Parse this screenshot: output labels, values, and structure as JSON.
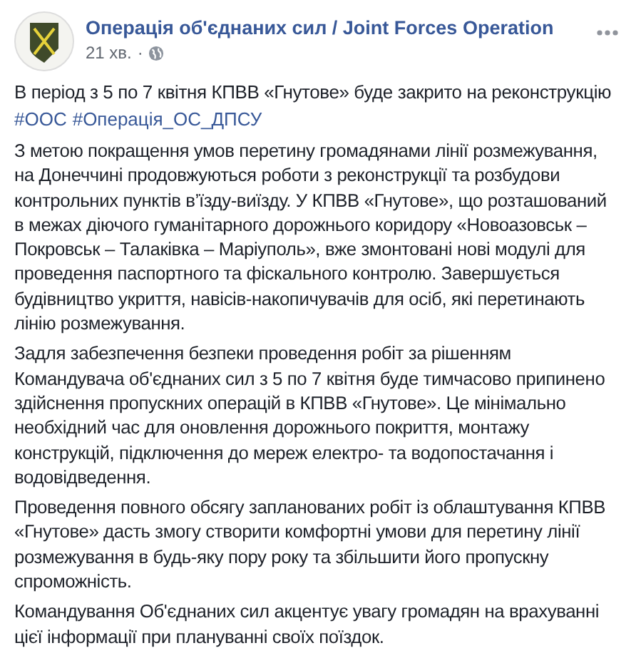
{
  "post": {
    "author": "Операція об'єднаних сил / Joint Forces Operation",
    "time": "21 хв.",
    "separator": "·",
    "headline": "В період з 5 по 7 квітня КПВВ «Гнутове» буде закрито на реконструкцію",
    "hashtags": [
      "#ООС",
      "#Операція_ОС_ДПСУ"
    ],
    "paragraphs": [
      "З метою покращення умов перетину громадянами лінії розмежування, на Донеччині продовжуються роботи з реконструкції та розбудови контрольних пунктів в’їзду-виїзду. У КПВВ «Гнутове», що розташований в межах діючого гуманітарного дорожнього коридору «Новоазовськ – Покровськ – Талаківка – Маріуполь», вже змонтовані нові модулі для проведення паспортного та фіскального контролю. Завершується будівництво укриття, навісів-накопичувачів для осіб, які перетинають лінію розмежування.",
      "Задля забезпечення безпеки проведення робіт за рішенням Командувача об'єднаних сил з 5 по 7 квітня буде тимчасово припинено здійснення пропускних операцій в КПВВ «Гнутове». Це мінімально необхідний час для оновлення дорожнього покриття, монтажу конструкцій, підключення до мереж електро- та водопостачання і водовідведення.",
      "Проведення повного обсягу запланованих робіт із облаштування КПВВ «Гнутове» дасть змогу створити комфортні умови для перетину лінії розмежування в будь-яку пору року та збільшити його пропускну спроможність.",
      "Командування Об'єднаних сил акцентує увагу громадян на врахуванні цієї інформації при плануванні своїх поїздок."
    ]
  }
}
